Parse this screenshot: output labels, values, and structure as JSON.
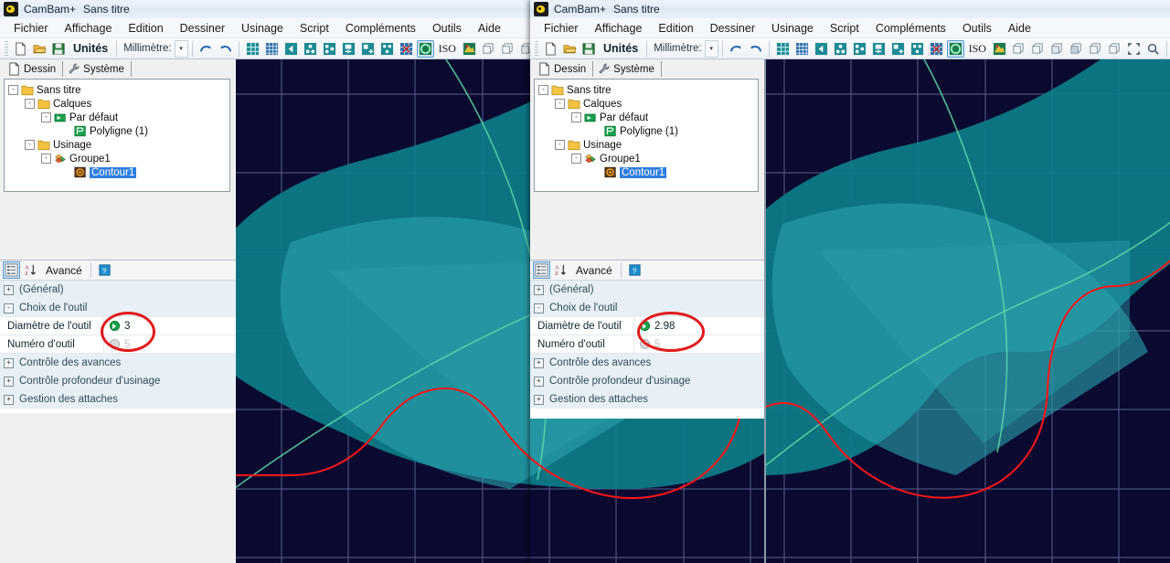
{
  "app": {
    "title": "CamBam+",
    "document": "Sans titre",
    "icon": "cambam-logo-icon"
  },
  "menu": {
    "items": [
      {
        "label": "Fichier"
      },
      {
        "label": "Affichage"
      },
      {
        "label": "Edition"
      },
      {
        "label": "Dessiner"
      },
      {
        "label": "Usinage"
      },
      {
        "label": "Script"
      },
      {
        "label": "Compléments"
      },
      {
        "label": "Outils"
      },
      {
        "label": "Aide"
      }
    ]
  },
  "toolbar": {
    "new_icon": "new-document-icon",
    "open_icon": "open-folder-icon",
    "save_icon": "save-disk-icon",
    "units_label": "Unités",
    "units_value": "Millimètre:",
    "units_caret": "▾",
    "undo_icon": "undo-arrow-icon",
    "redo_icon": "redo-arrow-icon",
    "iso_label": "ISO",
    "icons": [
      "snap-grid-icon",
      "show-grid-icon",
      "grid-left-icon",
      "grid-origin-icon",
      "grid-nodes-icon",
      "grid-add-icon",
      "grid-plus-icon",
      "grid-points-icon",
      "grid-red-icon",
      "shade-toggle-icon",
      "color-palette-icon",
      "view-box-1-icon",
      "view-box-2-icon",
      "view-box-3-icon",
      "view-box-4-icon",
      "view-box-5-icon",
      "view-box-6-icon",
      "zoom-fit-icon",
      "zoom-window-icon",
      "polyline-icon",
      "circle-icon",
      "points-icon",
      "rect-icon",
      "text-icon"
    ]
  },
  "tabs": {
    "items": [
      {
        "label": "Dessin",
        "icon": "page-icon",
        "active": true
      },
      {
        "label": "Système",
        "icon": "wrench-icon",
        "active": false
      }
    ]
  },
  "tree": {
    "nodes": [
      {
        "label": "Sans titre",
        "depth": 0,
        "expander": "-",
        "icon": "folder-icon",
        "selected": false
      },
      {
        "label": "Calques",
        "depth": 1,
        "expander": "-",
        "icon": "folder-icon",
        "selected": false
      },
      {
        "label": "Par défaut",
        "depth": 2,
        "expander": "-",
        "icon": "layer-icon",
        "selected": false
      },
      {
        "label": "Polyligne (1)",
        "depth": 3,
        "expander": "",
        "icon": "polyline-icon",
        "selected": false
      },
      {
        "label": "Usinage",
        "depth": 1,
        "expander": "-",
        "icon": "folder-icon",
        "selected": false
      },
      {
        "label": "Groupe1",
        "depth": 2,
        "expander": "-",
        "icon": "group-icon",
        "selected": false
      },
      {
        "label": "Contour1",
        "depth": 3,
        "expander": "",
        "icon": "contour-icon",
        "selected": true
      }
    ]
  },
  "properties": {
    "toolbar": {
      "categorized_icon": "categorized-view-icon",
      "alphabetical_icon": "sort-alpha-icon",
      "advanced_label": "Avancé",
      "help_icon": "help-icon"
    },
    "rows_left": [
      {
        "kind": "cat",
        "expander": "+",
        "label": "(Général)"
      },
      {
        "kind": "cat",
        "expander": "-",
        "label": "Choix de l'outil"
      },
      {
        "kind": "val",
        "label": "Diamètre de l'outil",
        "value": "3",
        "marker": "green",
        "dim": false
      },
      {
        "kind": "val",
        "label": "Numéro d'outil",
        "value": "5",
        "marker": "gray",
        "dim": true
      },
      {
        "kind": "cat",
        "expander": "+",
        "label": "Contrôle des avances"
      },
      {
        "kind": "cat",
        "expander": "+",
        "label": "Contrôle profondeur d'usinage"
      },
      {
        "kind": "cat",
        "expander": "+",
        "label": "Gestion des attaches"
      }
    ],
    "rows_right": [
      {
        "kind": "cat",
        "expander": "+",
        "label": "(Général)"
      },
      {
        "kind": "cat",
        "expander": "-",
        "label": "Choix de l'outil"
      },
      {
        "kind": "val",
        "label": "Diamètre de l'outil",
        "value": "2.98",
        "marker": "green",
        "dim": false
      },
      {
        "kind": "val",
        "label": "Numéro d'outil",
        "value": "5",
        "marker": "gray",
        "dim": true
      },
      {
        "kind": "cat",
        "expander": "+",
        "label": "Contrôle des avances"
      },
      {
        "kind": "cat",
        "expander": "+",
        "label": "Contrôle profondeur d'usinage"
      },
      {
        "kind": "cat",
        "expander": "+",
        "label": "Gestion des attaches"
      }
    ]
  },
  "annotation": {
    "shape": "red-ellipse-highlight",
    "color": "#e01b1b"
  },
  "viewport": {
    "background": "#0a0a30",
    "grid_color": "#9aa7d6",
    "stock_color": "#0d7a86",
    "arc_color": "#3fd6a0",
    "toolpath_color": "#ff0000",
    "label": "cad-drawing-canvas"
  }
}
